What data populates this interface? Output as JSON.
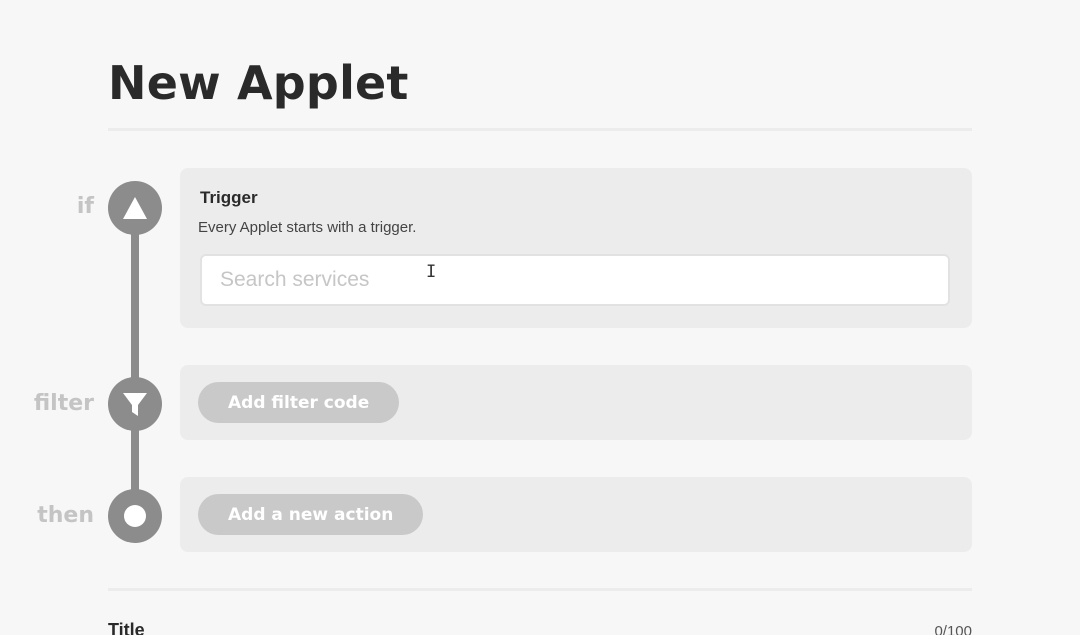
{
  "header": {
    "title": "New Applet"
  },
  "steps": {
    "if": {
      "label": "if",
      "icon": "triangle-icon"
    },
    "filter": {
      "label": "filter",
      "icon": "funnel-icon"
    },
    "then": {
      "label": "then",
      "icon": "ring-icon"
    }
  },
  "trigger": {
    "title": "Trigger",
    "subtitle": "Every Applet starts with a trigger.",
    "search_placeholder": "Search services",
    "search_value": ""
  },
  "filter": {
    "button_label": "Add filter code"
  },
  "action": {
    "button_label": "Add a new action"
  },
  "title_field": {
    "label": "Title",
    "counter": "0/100"
  },
  "colors": {
    "timeline": "#8c8c8c",
    "card_bg": "#ececec",
    "pill_bg": "#c9c9c9",
    "step_label": "#c4c4c4"
  }
}
